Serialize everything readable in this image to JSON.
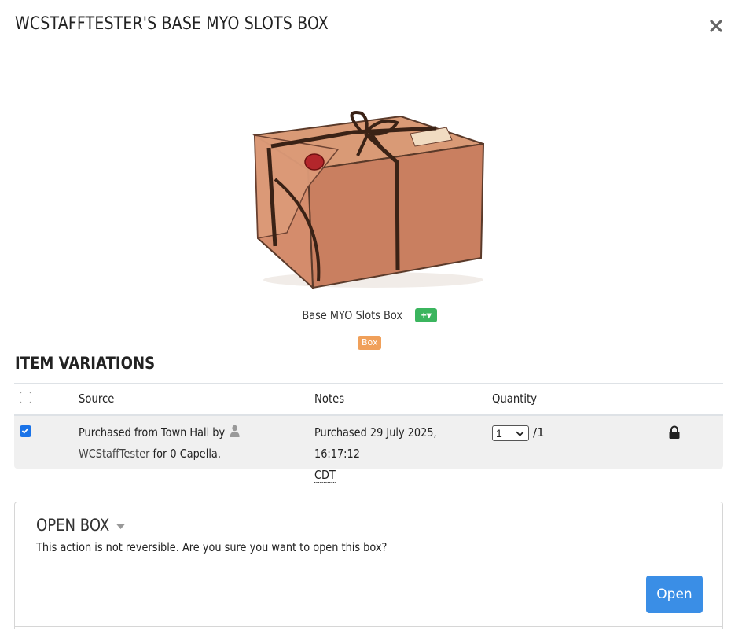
{
  "modal": {
    "title": "WCSTAFFTESTER'S BASE MYO SLOTS BOX",
    "close_label": "×"
  },
  "item": {
    "name": "Base MYO Slots Box",
    "add_button_label": "+▾",
    "badge": "Box",
    "badge_color": "#f0a05a"
  },
  "variations": {
    "title": "ITEM VARIATIONS",
    "headers": [
      "Source",
      "Notes",
      "Quantity"
    ],
    "rows": [
      {
        "checked": true,
        "source_prefix": "Purchased from Town Hall by",
        "source_user": "WCStaffTester",
        "source_suffix": "for 0 Capella.",
        "notes_prefix": "Purchased 29 July 2025, 16:17:12",
        "notes_tz": "CDT",
        "quantity_selected": "1",
        "quantity_total": "/1",
        "lock_icon": "lock-icon"
      }
    ]
  },
  "open_box": {
    "title": "OPEN BOX",
    "warning": "This action is not reversible. Are you sure you want to open this box?",
    "button_label": "Open",
    "button_color": "#3a8ee6"
  }
}
